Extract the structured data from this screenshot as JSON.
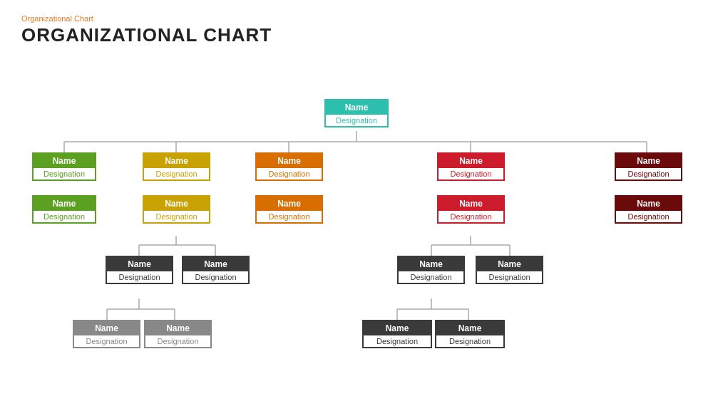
{
  "header": {
    "subtitle": "Organizational  Chart",
    "title": "ORGANIZATIONAL CHART"
  },
  "colors": {
    "teal": "#2dbfad",
    "green": "#5ba020",
    "yellow": "#c8a200",
    "orange": "#d86e00",
    "red": "#cc1c2b",
    "darkred": "#6b0a0a",
    "dark": "#3a3a3a",
    "gray": "#888888"
  },
  "nodes": {
    "root": {
      "name": "Name",
      "designation": "Designation"
    },
    "l1_green_1": {
      "name": "Name",
      "designation": "Designation"
    },
    "l1_green_2": {
      "name": "Name",
      "designation": "Designation"
    },
    "l1_yellow_1": {
      "name": "Name",
      "designation": "Designation"
    },
    "l1_yellow_2": {
      "name": "Name",
      "designation": "Designation"
    },
    "l1_orange_1": {
      "name": "Name",
      "designation": "Designation"
    },
    "l1_orange_2": {
      "name": "Name",
      "designation": "Designation"
    },
    "l1_red_1": {
      "name": "Name",
      "designation": "Designation"
    },
    "l1_red_2": {
      "name": "Name",
      "designation": "Designation"
    },
    "l1_dred_1": {
      "name": "Name",
      "designation": "Designation"
    },
    "l1_dred_2": {
      "name": "Name",
      "designation": "Designation"
    },
    "l2_dark_1": {
      "name": "Name",
      "designation": "Designation"
    },
    "l2_dark_2": {
      "name": "Name",
      "designation": "Designation"
    },
    "l2_dark_3": {
      "name": "Name",
      "designation": "Designation"
    },
    "l2_dark_4": {
      "name": "Name",
      "designation": "Designation"
    },
    "l3_gray_1": {
      "name": "Name",
      "designation": "Designation"
    },
    "l3_gray_2": {
      "name": "Name",
      "designation": "Designation"
    },
    "l3_dark_1": {
      "name": "Name",
      "designation": "Designation"
    },
    "l3_dark_2": {
      "name": "Name",
      "designation": "Designation"
    }
  }
}
